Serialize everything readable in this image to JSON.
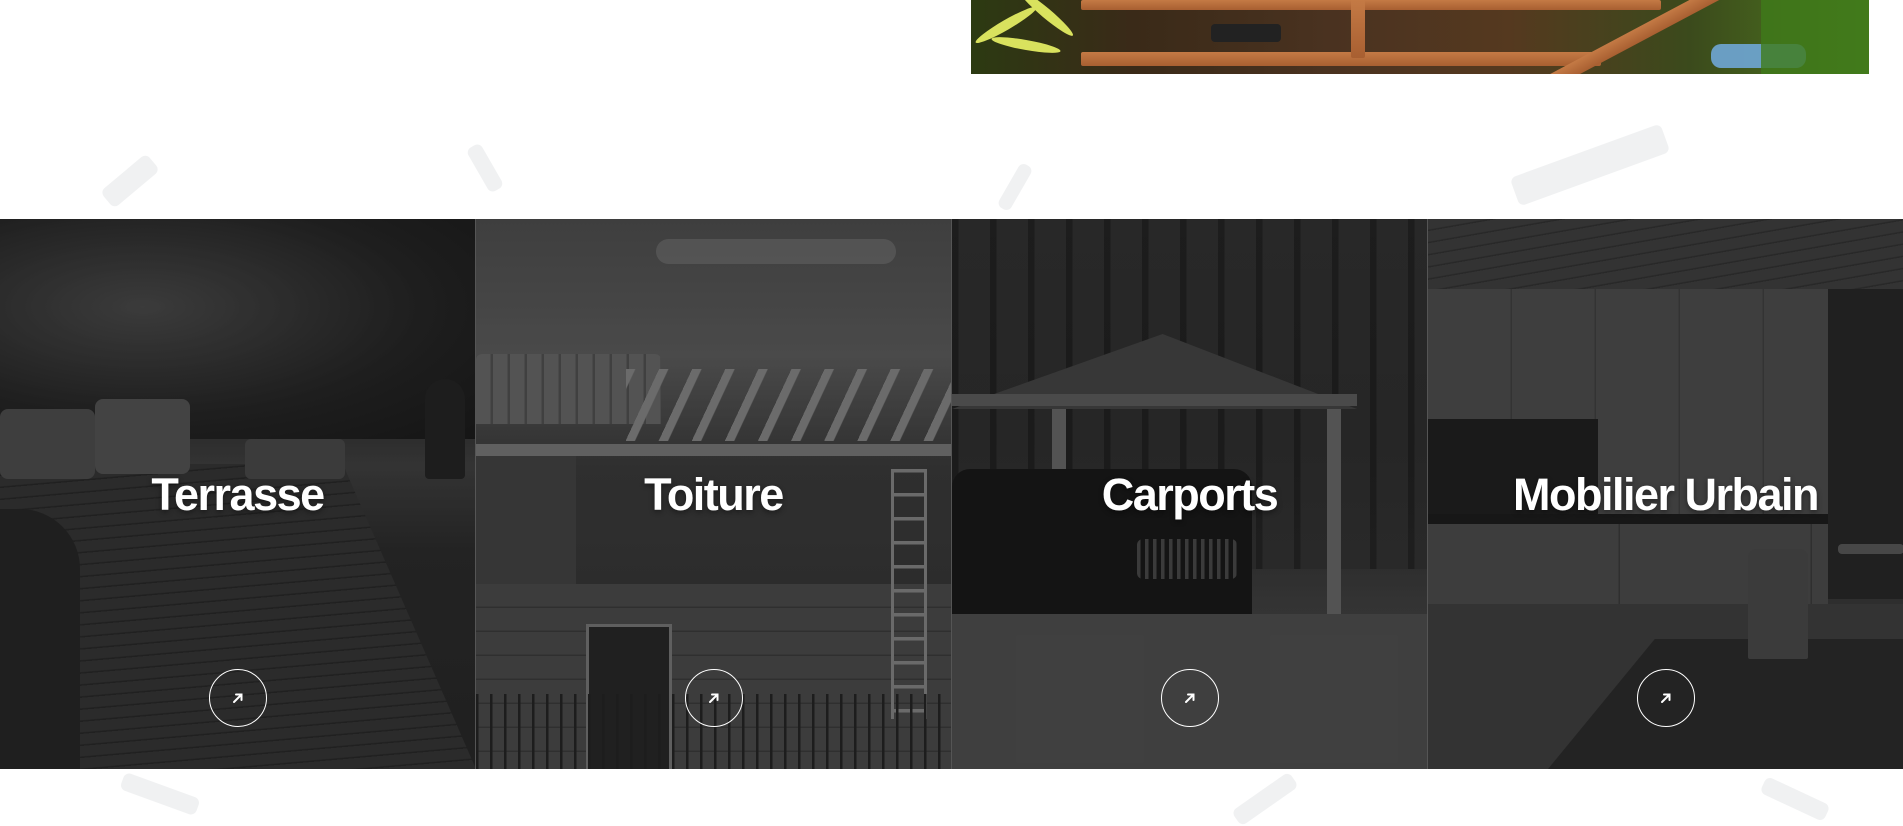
{
  "categories": [
    {
      "id": "terrasse",
      "title": "Terrasse",
      "link_icon": "arrow-up-right-icon"
    },
    {
      "id": "toiture",
      "title": "Toiture",
      "link_icon": "arrow-up-right-icon"
    },
    {
      "id": "carports",
      "title": "Carports",
      "link_icon": "arrow-up-right-icon"
    },
    {
      "id": "mobilier-urbain",
      "title": "Mobilier Urbain",
      "link_icon": "arrow-up-right-icon"
    }
  ],
  "colors": {
    "page_background": "#ffffff",
    "title_text": "#ffffff",
    "overlay": "#000000"
  }
}
